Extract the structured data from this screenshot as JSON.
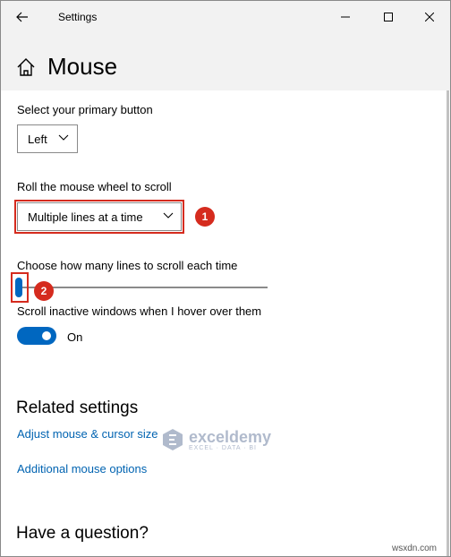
{
  "window": {
    "title": "Settings"
  },
  "page": {
    "title": "Mouse"
  },
  "primary_button": {
    "label": "Select your primary button",
    "value": "Left"
  },
  "wheel_scroll": {
    "label": "Roll the mouse wheel to scroll",
    "value": "Multiple lines at a time"
  },
  "lines_to_scroll": {
    "label": "Choose how many lines to scroll each time"
  },
  "inactive_scroll": {
    "label": "Scroll inactive windows when I hover over them",
    "state": "On"
  },
  "related": {
    "title": "Related settings",
    "links": [
      "Adjust mouse & cursor size",
      "Additional mouse options"
    ]
  },
  "question": {
    "title": "Have a question?"
  },
  "annotations": [
    "1",
    "2"
  ],
  "watermark": {
    "name": "exceldemy",
    "tagline": "EXCEL · DATA · BI"
  },
  "footer": "wsxdn.com",
  "colors": {
    "accent": "#0067c0",
    "link": "#0063b1",
    "annotation": "#d52b1e",
    "header_bg": "#f2f2f2"
  }
}
